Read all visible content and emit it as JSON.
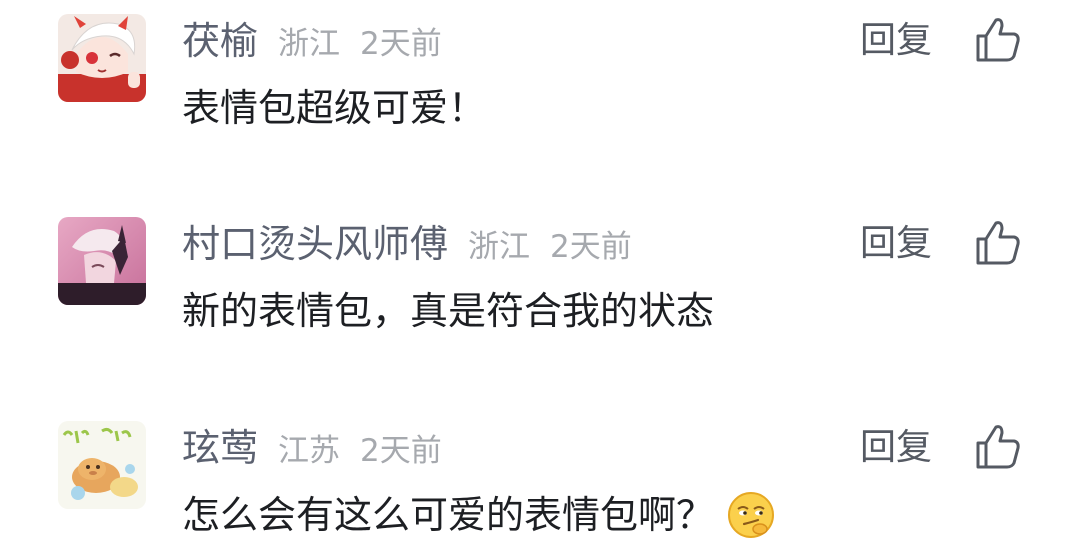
{
  "comments": [
    {
      "username": "茯榆",
      "location": "浙江",
      "time": "2天前",
      "text": "表情包超级可爱！",
      "reply_label": "回复",
      "avatar_icon": "anime-avatar-red-icon",
      "like_icon": "thumbs-up-icon"
    },
    {
      "username": "村口烫头风师傅",
      "location": "浙江",
      "time": "2天前",
      "text": "新的表情包，真是符合我的状态",
      "reply_label": "回复",
      "avatar_icon": "anime-avatar-pink-icon",
      "like_icon": "thumbs-up-icon"
    },
    {
      "username": "玹莺",
      "location": "江苏",
      "time": "2天前",
      "text": "怎么会有这么可爱的表情包啊？",
      "reply_label": "回复",
      "avatar_icon": "capybara-avatar-icon",
      "like_icon": "thumbs-up-icon",
      "trailing_emoji": "smirk-emoji-icon"
    }
  ],
  "colors": {
    "username": "#5b6170",
    "meta": "#a6a9ae",
    "text": "#1d1f23",
    "reply": "#555a63"
  }
}
